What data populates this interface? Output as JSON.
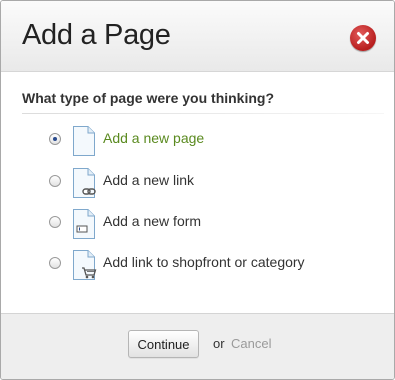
{
  "dialog": {
    "title": "Add a Page",
    "close_icon": "close-icon",
    "colors": {
      "close": "#c0282b",
      "selected_option": "#5a8a1f"
    }
  },
  "question": "What type of page were you thinking?",
  "options": [
    {
      "label": "Add a new page",
      "icon": "page-icon",
      "selected": true
    },
    {
      "label": "Add a new link",
      "icon": "page-link-icon",
      "selected": false
    },
    {
      "label": "Add a new form",
      "icon": "page-form-icon",
      "selected": false
    },
    {
      "label": "Add link to shopfront or category",
      "icon": "page-cart-icon",
      "selected": false
    }
  ],
  "footer": {
    "continue_label": "Continue",
    "or_text": "or",
    "cancel_label": "Cancel"
  }
}
